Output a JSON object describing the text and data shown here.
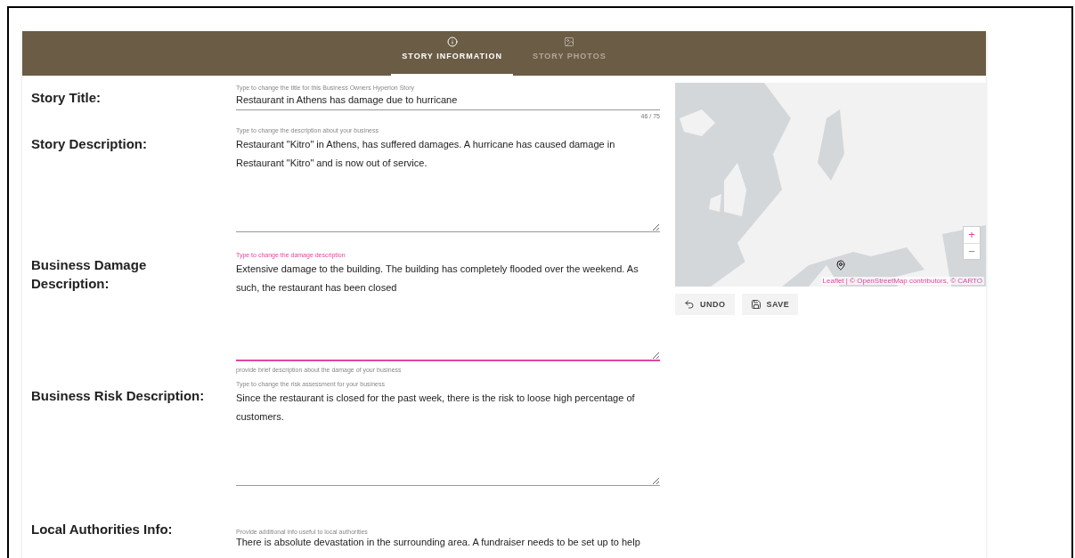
{
  "tabs": [
    {
      "label": "STORY INFORMATION",
      "selected": true
    },
    {
      "label": "STORY PHOTOS",
      "selected": false
    }
  ],
  "fields": [
    {
      "label": "Story Title:",
      "kind": "input",
      "hint": "Type to change the title for this Business Owners Hyperion Story",
      "value": "Restaurant in Athens has damage due to hurricane",
      "counter": "46 / 75",
      "focused": false
    },
    {
      "label": "Story Description:",
      "kind": "textarea",
      "hint": "Type to change the description about your business",
      "value": "Restaurant \"Kitro\" in Athens, has suffered damages. A hurricane has caused damage in Restaurant \"Kitro\" and is now out of service.",
      "focused": false
    },
    {
      "label": "Business Damage Description:",
      "kind": "textarea",
      "hint": "Type to change the damage description",
      "value": "Extensive damage to the building. The building has completely flooded over the weekend. As such, the restaurant has been closed",
      "helper": "provide brief description about the damage of your business",
      "focused": true
    },
    {
      "label": "Business Risk Description:",
      "kind": "textarea",
      "hint": "Type to change the risk assessment for your business",
      "value": "Since the restaurant is closed for the past week, there is the risk to loose high percentage of customers.",
      "focused": false
    },
    {
      "label": "Local Authorities Info:",
      "kind": "cut",
      "hint": "Provide additional info useful to local authorities",
      "value": "There is absolute devastation in the surrounding area. A fundraiser needs to be set up to help"
    }
  ],
  "map": {
    "kind": "picture",
    "zoom_in": "+",
    "zoom_out": "−",
    "attribution": "Leaflet | © OpenStreetMap contributors, © CARTO"
  },
  "actions": [
    {
      "label": "UNDO"
    },
    {
      "label": "SAVE"
    }
  ]
}
